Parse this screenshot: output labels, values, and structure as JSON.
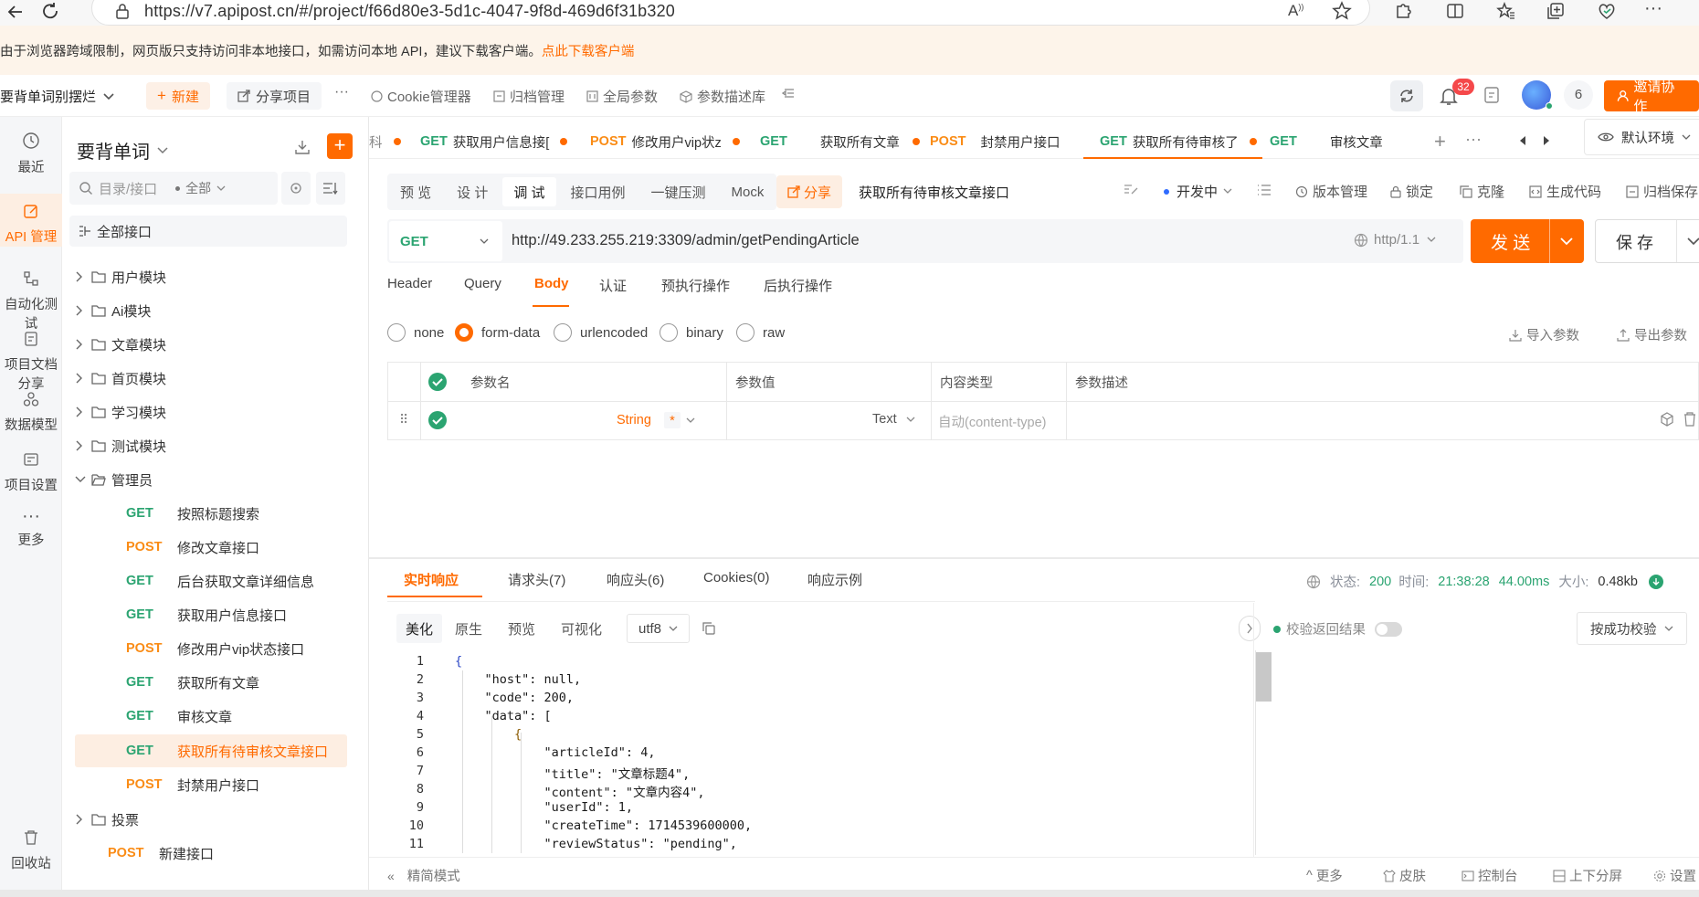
{
  "browser": {
    "url": "https://v7.apipost.cn/#/project/f66d80e3-5d1c-4047-9f8d-469d6f31b320"
  },
  "notice": {
    "text": "由于浏览器跨域限制，网页版只支持访问非本地接口，如需访问本地 API，建议下载客户端。",
    "link": "点此下载客户端"
  },
  "toolbar": {
    "project": "要背单词别摆烂",
    "new": "新建",
    "share": "分享项目",
    "more": "···",
    "cookie": "Cookie管理器",
    "archive": "归档管理",
    "global_params": "全局参数",
    "param_lib": "参数描述库",
    "notifications": "32",
    "members": "6",
    "invite": "邀请协作"
  },
  "rail": [
    {
      "label": "最近"
    },
    {
      "label": "API 管理"
    },
    {
      "label": "自动化测试"
    },
    {
      "label": "项目文档分享"
    },
    {
      "label": "数据模型"
    },
    {
      "label": "项目设置"
    },
    {
      "label": "更多"
    },
    {
      "label": "回收站"
    }
  ],
  "sidebar": {
    "title": "要背单词",
    "search_placeholder": "目录/接口",
    "filter": "全部",
    "all_apis": "全部接口",
    "folders": [
      "用户模块",
      "Ai模块",
      "文章模块",
      "首页模块",
      "学习模块",
      "测试模块",
      "管理员"
    ],
    "admin_items": [
      {
        "method": "GET",
        "name": "按照标题搜索"
      },
      {
        "method": "POST",
        "name": "修改文章接口"
      },
      {
        "method": "GET",
        "name": "后台获取文章详细信息"
      },
      {
        "method": "GET",
        "name": "获取用户信息接口"
      },
      {
        "method": "POST",
        "name": "修改用户vip状态接口"
      },
      {
        "method": "GET",
        "name": "获取所有文章"
      },
      {
        "method": "GET",
        "name": "审核文章"
      },
      {
        "method": "GET",
        "name": "获取所有待审核文章接口"
      },
      {
        "method": "POST",
        "name": "封禁用户接口"
      }
    ],
    "vote_folder": "投票",
    "new_item": {
      "method": "POST",
      "name": "新建接口"
    }
  },
  "tabs": [
    {
      "method": "",
      "name": "科"
    },
    {
      "method": "GET",
      "name": "获取用户信息接["
    },
    {
      "method": "POST",
      "name": "修改用户vip状z"
    },
    {
      "method": "GET",
      "name": "获取所有文章"
    },
    {
      "method": "POST",
      "name": "封禁用户接口"
    },
    {
      "method": "GET",
      "name": "获取所有待审核了"
    },
    {
      "method": "GET",
      "name": "审核文章"
    }
  ],
  "env": "默认环境",
  "mode_tabs": [
    "预 览",
    "设 计",
    "调 试",
    "接口用例",
    "一键压测",
    "Mock"
  ],
  "share_btn": "分享",
  "api_name": "获取所有待审核文章接口",
  "status": "开发中",
  "actions": [
    "版本管理",
    "锁定",
    "克隆",
    "生成代码",
    "归档保存"
  ],
  "request": {
    "method": "GET",
    "url": "http://49.233.255.219:3309/admin/getPendingArticle",
    "protocol": "http/1.1",
    "send": "发 送",
    "save": "保 存"
  },
  "req_tabs": [
    "Header",
    "Query",
    "Body",
    "认证",
    "预执行操作",
    "后执行操作"
  ],
  "body_types": [
    "none",
    "form-data",
    "urlencoded",
    "binary",
    "raw"
  ],
  "import_params": "导入参数",
  "export_params": "导出参数",
  "params_table": {
    "headers": [
      "参数名",
      "参数值",
      "内容类型",
      "参数描述"
    ],
    "row": {
      "type": "String",
      "required": "*",
      "value_type": "Text",
      "content_type": "自动(content-type)"
    }
  },
  "response": {
    "tabs": [
      "实时响应",
      "请求头(7)",
      "响应头(6)",
      "Cookies(0)",
      "响应示例"
    ],
    "status_label": "状态:",
    "status": "200",
    "time_label": "时间:",
    "time": "21:38:28",
    "duration": "44.00ms",
    "size_label": "大小:",
    "size": "0.48kb",
    "view_tabs": [
      "美化",
      "原生",
      "预览",
      "可视化"
    ],
    "encoding": "utf8",
    "validate": "校验返回结果",
    "validate_mode": "按成功校验"
  },
  "code_lines": [
    "{",
    "    \"host\": null,",
    "    \"code\": 200,",
    "    \"data\": [",
    "        {",
    "            \"articleId\": 4,",
    "            \"title\": \"文章标题4\",",
    "            \"content\": \"文章内容4\",",
    "            \"userId\": 1,",
    "            \"createTime\": 1714539600000,",
    "            \"reviewStatus\": \"pending\","
  ],
  "bottom": {
    "simple": "精简模式",
    "more": "更多",
    "skin": "皮肤",
    "console": "控制台",
    "split": "上下分屏",
    "settings": "设置"
  }
}
